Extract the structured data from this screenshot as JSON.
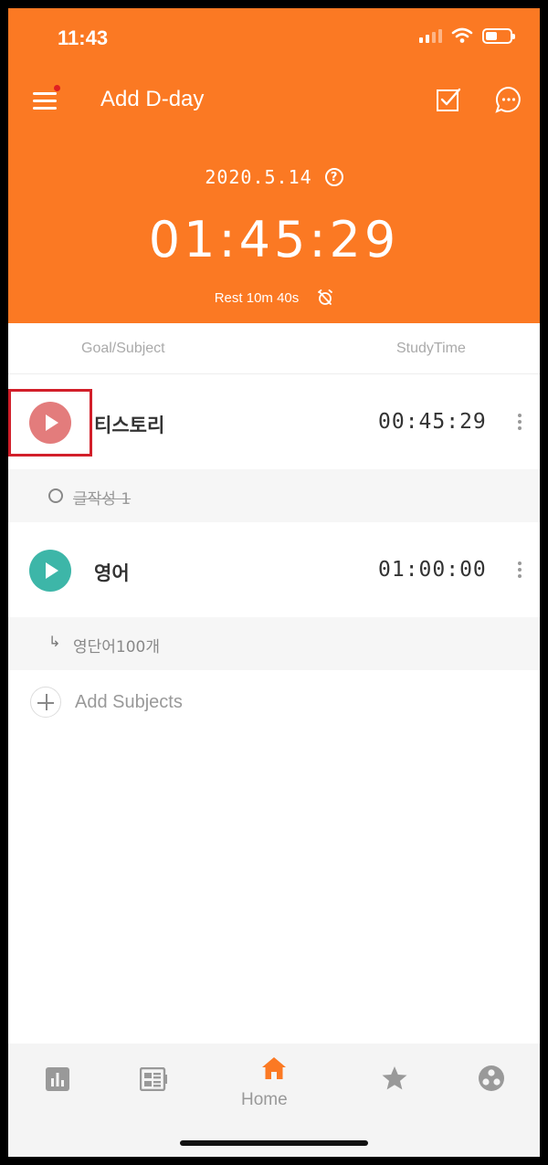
{
  "status_bar": {
    "time": "11:43"
  },
  "header": {
    "title": "Add D-day",
    "date": "2020.5.14",
    "help_glyph": "?",
    "timer": "01:45:29",
    "rest": "Rest  10m 40s"
  },
  "columns": {
    "left": "Goal/Subject",
    "right": "StudyTime"
  },
  "subjects": [
    {
      "name": "티스토리",
      "time": "00:45:29",
      "color": "#E37C7C",
      "goal": "글작성 1",
      "goal_done": true
    },
    {
      "name": "영어",
      "time": "01:00:00",
      "color": "#3DB6A8",
      "goal": "영단어100개",
      "goal_done": false
    }
  ],
  "goal_arrow": "↳",
  "add_subjects": "Add Subjects",
  "nav": {
    "home_label": "Home"
  },
  "colors": {
    "accent": "#FB7923",
    "highlight": "#D21F2A",
    "inactive": "#999999"
  }
}
